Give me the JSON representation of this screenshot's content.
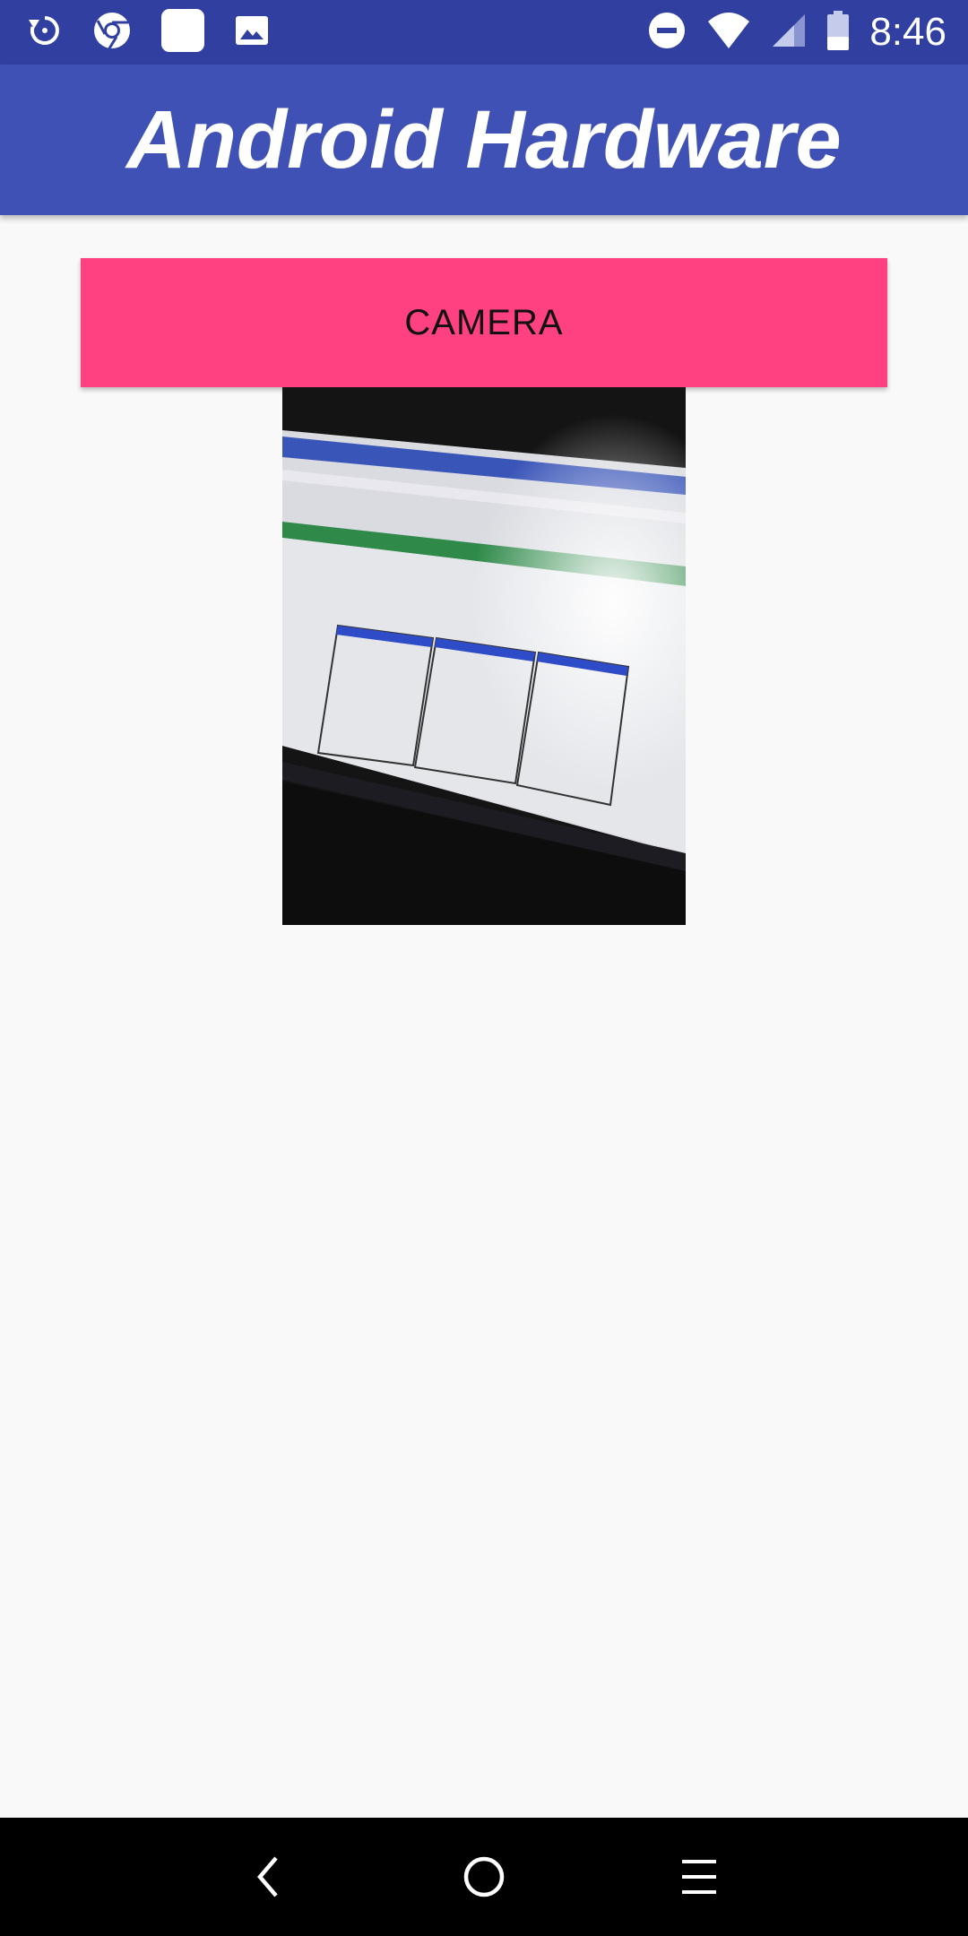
{
  "status_bar": {
    "time": "8:46",
    "left_icons": [
      "sync-icon",
      "chrome-icon",
      "app-notification-icon",
      "image-icon"
    ],
    "right_icons": [
      "do-not-disturb-icon",
      "wifi-icon",
      "cellular-signal-icon",
      "battery-icon"
    ]
  },
  "app_bar": {
    "title": "Android Hardware"
  },
  "main": {
    "camera_button_label": "CAMERA",
    "photo_description_icon": "captured-photo"
  },
  "nav_bar": {
    "icons": [
      "back-icon",
      "home-icon",
      "recents-icon"
    ]
  },
  "colors": {
    "status_bar": "#3140a0",
    "app_bar": "#3f51b5",
    "accent": "#ff4081",
    "background": "#f9f9f9",
    "nav_bar": "#000000"
  }
}
